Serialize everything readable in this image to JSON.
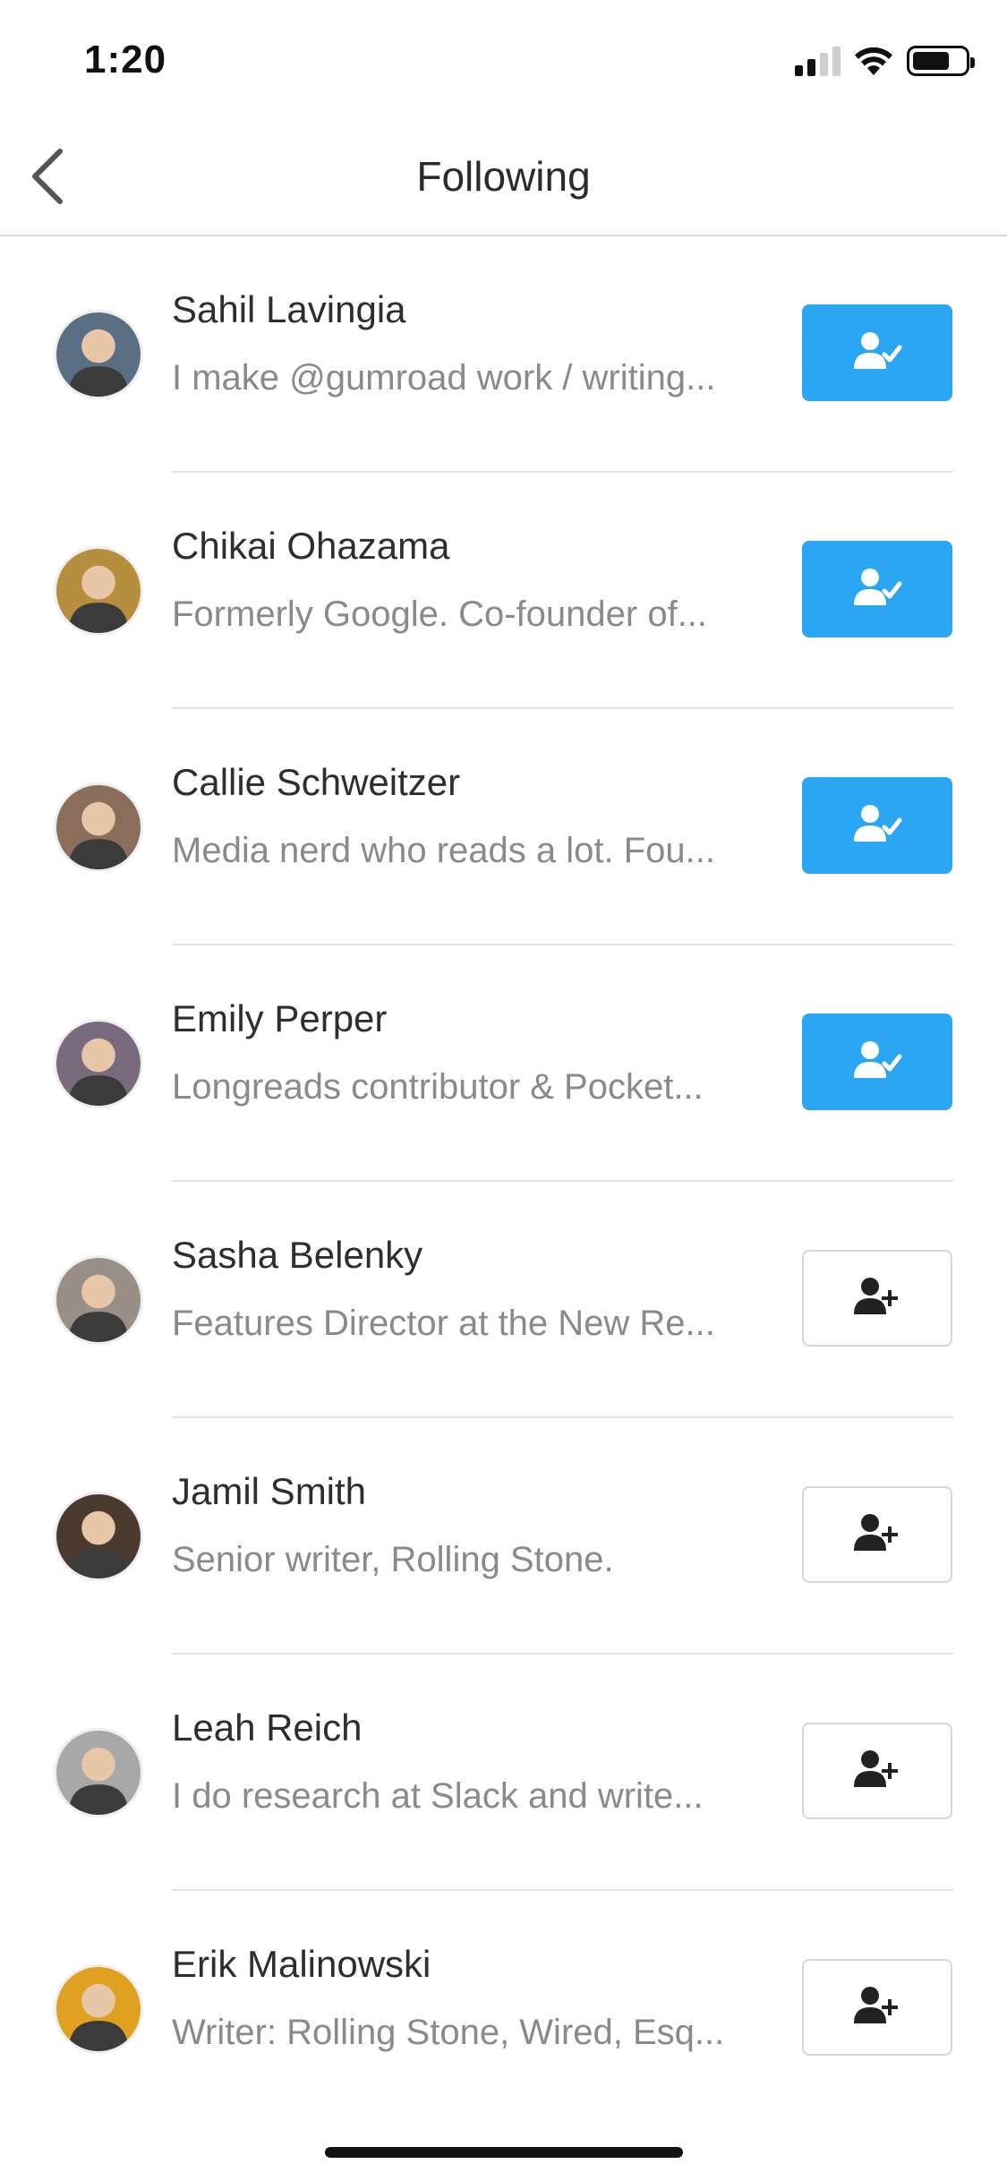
{
  "status_bar": {
    "time": "1:20",
    "icons": [
      "signal-icon",
      "wifi-icon",
      "battery-icon"
    ]
  },
  "nav": {
    "title": "Following",
    "back_icon": "chevron-left-icon"
  },
  "colors": {
    "accent": "#2aa6f2",
    "divider": "#e3e3e3",
    "subtitle": "#8a8a8a"
  },
  "people": [
    {
      "name": "Sahil Lavingia",
      "bio": "I make @gumroad work / writing...",
      "following": true,
      "avatar_color": "#5a6e84"
    },
    {
      "name": "Chikai Ohazama",
      "bio": "Formerly Google. Co-founder of...",
      "following": true,
      "avatar_color": "#b78d3e"
    },
    {
      "name": "Callie Schweitzer",
      "bio": "Media nerd who reads a lot. Fou...",
      "following": true,
      "avatar_color": "#8a6d5a"
    },
    {
      "name": "Emily Perper",
      "bio": "Longreads contributor & Pocket...",
      "following": true,
      "avatar_color": "#7a6a7e"
    },
    {
      "name": "Sasha Belenky",
      "bio": "Features Director at the New Re...",
      "following": false,
      "avatar_color": "#9a8f86"
    },
    {
      "name": "Jamil Smith",
      "bio": "Senior writer, Rolling Stone.",
      "following": false,
      "avatar_color": "#4a3a30"
    },
    {
      "name": "Leah Reich",
      "bio": "I do research at Slack and write...",
      "following": false,
      "avatar_color": "#a8a8a8"
    },
    {
      "name": "Erik Malinowski",
      "bio": "Writer: Rolling Stone, Wired, Esq...",
      "following": false,
      "avatar_color": "#e0a020"
    }
  ]
}
